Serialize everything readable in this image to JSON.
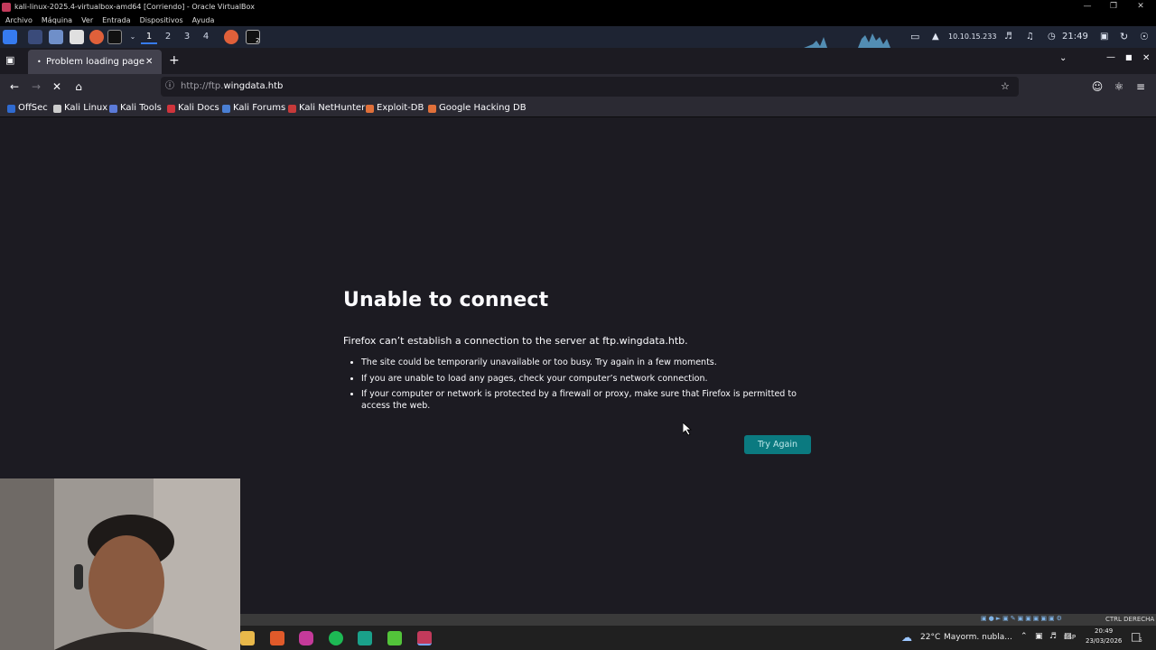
{
  "vbox": {
    "title": "kali-linux-2025.4-virtualbox-amd64 [Corriendo] - Oracle VirtualBox",
    "menu": [
      "Archivo",
      "Máquina",
      "Ver",
      "Entrada",
      "Dispositivos",
      "Ayuda"
    ],
    "status_right": "CTRL DERECHA"
  },
  "kali_panel": {
    "workspaces": [
      "1",
      "2",
      "3",
      "4"
    ],
    "ip": "10.10.15.233",
    "clock": "21:49",
    "terminal_badge": "2"
  },
  "firefox": {
    "tab_title": "Problem loading page",
    "url_prefix": "http://ftp.",
    "url_domain": "wingdata.htb",
    "bookmarks": [
      "OffSec",
      "Kali Linux",
      "Kali Tools",
      "Kali Docs",
      "Kali Forums",
      "Kali NetHunter",
      "Exploit-DB",
      "Google Hacking DB"
    ]
  },
  "error": {
    "title": "Unable to connect",
    "description": "Firefox can’t establish a connection to the server at ftp.wingdata.htb.",
    "items": [
      "The site could be temporarily unavailable or too busy. Try again in a few moments.",
      "If you are unable to load any pages, check your computer’s network connection.",
      "If your computer or network is protected by a firewall or proxy, make sure that Firefox is permitted to access the web."
    ],
    "button": "Try Again"
  },
  "windows_taskbar": {
    "weather_temp": "22°C",
    "weather_text": "Mayorm. nubla...",
    "lang": "ESP",
    "time": "20:49",
    "date": "23/03/2026",
    "notif_count": "5"
  },
  "colors": {
    "accent": "#0b7a80",
    "page_bg": "#1c1b22",
    "toolbar_bg": "#2b2a33"
  }
}
